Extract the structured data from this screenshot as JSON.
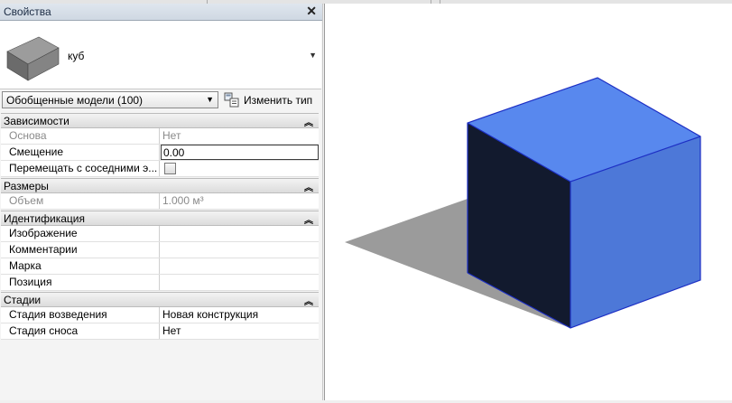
{
  "panel": {
    "title": "Свойства",
    "close_glyph": "✕",
    "type_name": "куб",
    "type_arrow": "▼",
    "selector_value": "Обобщенные модели (100)",
    "selector_arrow": "▼",
    "edit_type_label": "Изменить тип",
    "groups": {
      "constraints": {
        "label": "Зависимости",
        "rows": [
          {
            "key": "Основа",
            "value": "Нет"
          },
          {
            "key": "Смещение",
            "value": "0.00"
          },
          {
            "key": "Перемещать с соседними э..."
          }
        ]
      },
      "dimensions": {
        "label": "Размеры",
        "rows": [
          {
            "key": "Объем",
            "value": "1.000 м³"
          }
        ]
      },
      "identity": {
        "label": "Идентификация",
        "rows": [
          {
            "key": "Изображение",
            "value": ""
          },
          {
            "key": "Комментарии",
            "value": ""
          },
          {
            "key": "Марка",
            "value": ""
          },
          {
            "key": "Позиция",
            "value": ""
          }
        ]
      },
      "phasing": {
        "label": "Стадии",
        "rows": [
          {
            "key": "Стадия возведения",
            "value": "Новая конструкция"
          },
          {
            "key": "Стадия сноса",
            "value": "Нет"
          }
        ]
      }
    },
    "collapse_glyph": "≈"
  },
  "icons": {
    "close": "close-icon",
    "dropdown": "chevron-down-icon",
    "edit_type": "edit-type-icon",
    "collapse": "chevron-double-up-icon",
    "thumbnail": "box-thumbnail-icon"
  },
  "colors": {
    "cube_top": "#5888ee",
    "cube_right": "#4d78d8",
    "cube_left": "#121a2e",
    "shadow": "#9b9b9b",
    "edge": "#1d2fc4"
  }
}
